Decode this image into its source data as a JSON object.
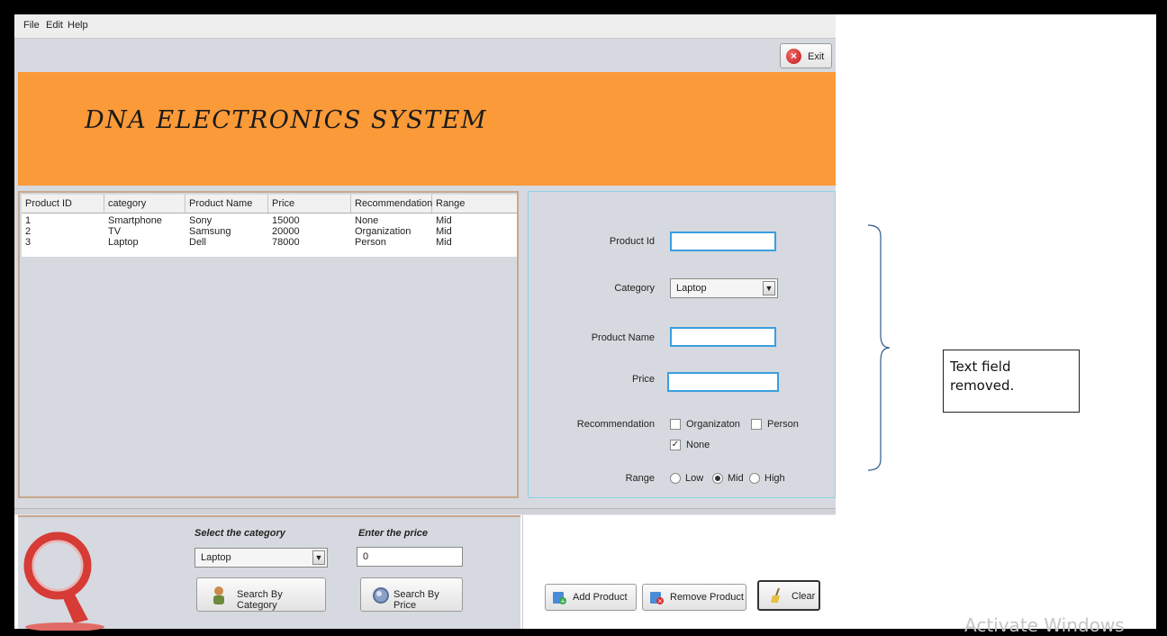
{
  "menu": {
    "file": "File",
    "edit": "Edit",
    "help": "Help"
  },
  "exit_button": {
    "label": "Exit",
    "icon": "close-circle-icon",
    "color": "#d22222"
  },
  "banner": {
    "title": "DNA ELECTRONICS SYSTEM",
    "color": "#fb9a38"
  },
  "table": {
    "columns": [
      "Product ID",
      "category",
      "Product Name",
      "Price",
      "Recommendation",
      "Range"
    ],
    "rows": [
      [
        "1",
        "Smartphone",
        "Sony",
        "15000",
        "None",
        "Mid"
      ],
      [
        "2",
        "TV",
        "Samsung",
        "20000",
        "Organization",
        "Mid"
      ],
      [
        "3",
        "Laptop",
        "Dell",
        "78000",
        "Person",
        "Mid"
      ]
    ]
  },
  "form": {
    "product_id_label": "Product Id",
    "product_id_value": "",
    "category_label": "Category",
    "category_value": "Laptop",
    "product_name_label": "Product Name",
    "product_name_value": "",
    "price_label": "Price",
    "price_value": "",
    "recommendation_label": "Recommendation",
    "rec_options": {
      "organization": "Organizaton",
      "person": "Person",
      "none": "None"
    },
    "rec_checked": {
      "organization": false,
      "person": false,
      "none": true
    },
    "range_label": "Range",
    "range_options": {
      "low": "Low",
      "mid": "Mid",
      "high": "High"
    },
    "range_selected": "Mid"
  },
  "search": {
    "category_heading": "Select the category",
    "category_value": "Laptop",
    "price_heading": "Enter the price",
    "price_value": "0",
    "by_category_button": "Search By Category",
    "by_price_button": "Search By Price"
  },
  "actions": {
    "add_button": "Add Product",
    "remove_button": "Remove Product",
    "clear_button": "Clear"
  },
  "annotation": {
    "note": "Text field removed."
  },
  "watermark": "Activate Windows"
}
